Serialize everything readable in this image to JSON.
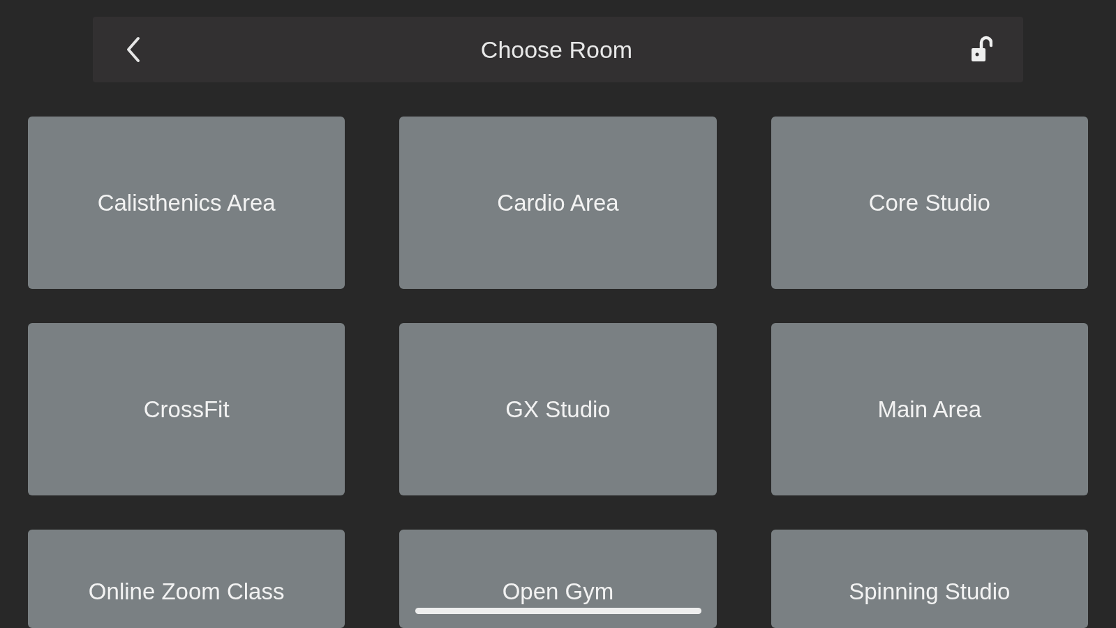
{
  "header": {
    "title": "Choose Room"
  },
  "rooms": [
    {
      "label": "Calisthenics Area"
    },
    {
      "label": "Cardio Area"
    },
    {
      "label": "Core Studio"
    },
    {
      "label": "CrossFit"
    },
    {
      "label": "GX Studio"
    },
    {
      "label": "Main Area"
    },
    {
      "label": "Online Zoom Class"
    },
    {
      "label": "Open Gym"
    },
    {
      "label": "Spinning Studio"
    }
  ]
}
